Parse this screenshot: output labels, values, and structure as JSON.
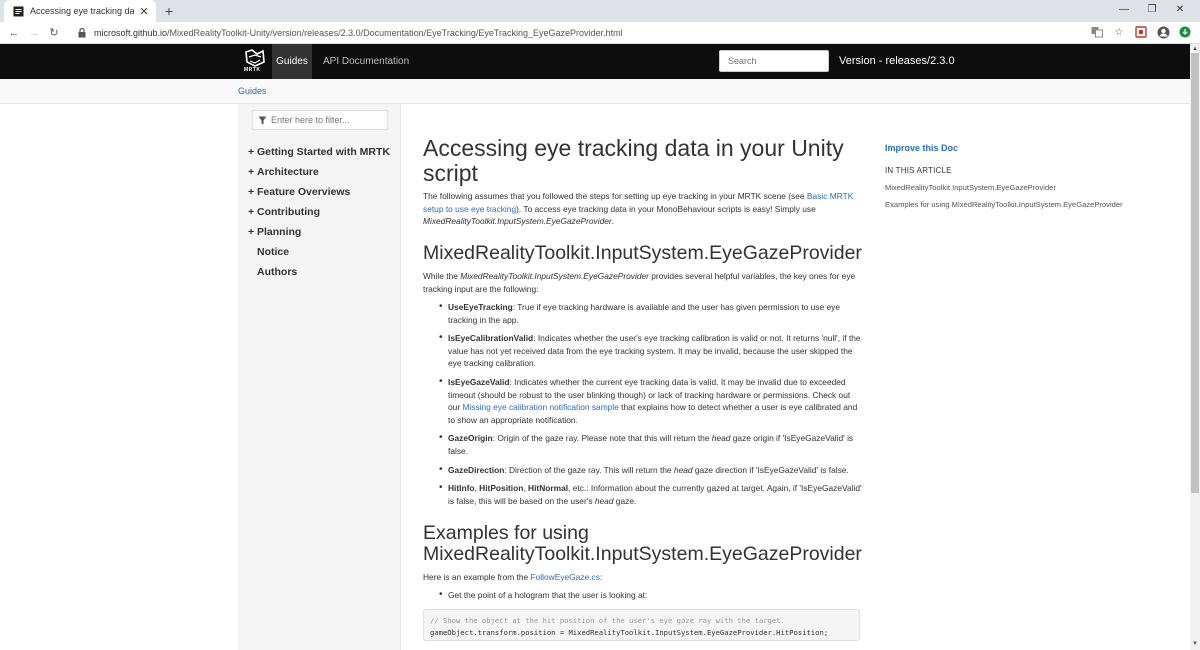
{
  "browser": {
    "tab_title": "Accessing eye tracking data in yo",
    "url_host": "microsoft.github.io",
    "url_path": "/MixedRealityToolkit-Unity/version/releases/2.3.0/Documentation/EyeTracking/EyeTracking_EyeGazeProvider.html"
  },
  "header": {
    "logo_text": "MRTK",
    "nav_guides": "Guides",
    "nav_api": "API Documentation",
    "search_placeholder": "Search",
    "version": "Version - releases/2.3.0"
  },
  "breadcrumb": "Guides",
  "sidebar": {
    "filter_placeholder": "Enter here to filter...",
    "items": [
      {
        "expander": "+",
        "label": "Getting Started with MRTK"
      },
      {
        "expander": "+",
        "label": "Architecture"
      },
      {
        "expander": "+",
        "label": "Feature Overviews"
      },
      {
        "expander": "+",
        "label": "Contributing"
      },
      {
        "expander": "+",
        "label": "Planning"
      },
      {
        "expander": "",
        "label": "Notice"
      },
      {
        "expander": "",
        "label": "Authors"
      }
    ]
  },
  "article": {
    "title": "Accessing eye tracking data in your Unity script",
    "intro_1": "The following assumes that you followed the steps for setting up eye tracking in your MRTK scene (see ",
    "intro_link": "Basic MRTK setup to use eye tracking",
    "intro_2": "). To access eye tracking data in your MonoBehaviour scripts is easy! Simply use ",
    "intro_em": "MixedRealityToolkit.InputSystem.EyeGazeProvider",
    "intro_3": ".",
    "h2_provider": "MixedRealityToolkit.InputSystem.EyeGazeProvider",
    "provider_p1": "While the ",
    "provider_em": "MixedRealityToolkit.InputSystem.EyeGazeProvider",
    "provider_p2": " provides several helpful variables, the key ones for eye tracking input are the following:",
    "items": {
      "use_term": "UseEyeTracking",
      "use_text": ": True if eye tracking hardware is available and the user has given permission to use eye tracking in the app.",
      "calib_term": "IsEyeCalibrationValid",
      "calib_text": ": Indicates whether the user's eye tracking calibration is valid or not. It returns 'null', if the value has not yet received data from the eye tracking system. It may be invalid, because the user skipped the eye tracking calibration.",
      "valid_term": "IsEyeGazeValid",
      "valid_text_1": ": Indicates whether the current eye tracking data is valid. It may be invalid due to exceeded timeout (should be robust to the user blinking though) or lack of tracking hardware or permissions. Check out our ",
      "valid_link": "Missing eye calibration notification sample",
      "valid_text_2": " that explains how to detect whether a user is eye calibrated and to show an appropriate notification.",
      "origin_term": "GazeOrigin",
      "origin_text_1": ": Origin of the gaze ray. Please note that this will return the ",
      "origin_em": "head",
      "origin_text_2": " gaze origin if 'IsEyeGazeValid' is false.",
      "dir_term": "GazeDirection",
      "dir_text_1": ": Direction of the gaze ray. This will return the ",
      "dir_em": "head",
      "dir_text_2": " gaze direction if 'IsEyeGazeValid' is false.",
      "hit_term_1": "HitInfo",
      "hit_sep_1": ", ",
      "hit_term_2": "HitPosition",
      "hit_sep_2": ", ",
      "hit_term_3": "HitNormal",
      "hit_text_1": ", etc.: Information about the currently gazed at target. Again, if 'IsEyeGazeValid' is false, this will be based on the user's ",
      "hit_em": "head",
      "hit_text_2": " gaze."
    },
    "h2_examples": "Examples for using MixedRealityToolkit.InputSystem.EyeGazeProvider",
    "examples_p1": "Here is an example from the ",
    "examples_link": "FollowEyeGaze.cs",
    "examples_p2": ":",
    "examples_li": "Get the point of a hologram that the user is looking at:",
    "code_comment": "// Show the object at the hit position of the user's eye gaze ray with the target.",
    "code_line": "gameObject.transform.position = MixedRealityToolkit.InputSystem.EyeGazeProvider.HitPosition;"
  },
  "affix": {
    "improve": "Improve this Doc",
    "in_this_article": "IN THIS ARTICLE",
    "links": [
      "MixedRealityToolkit.InputSystem.EyeGazeProvider",
      "Examples for using MixedRealityToolkit.InputSystem.EyeGazeProvider"
    ]
  },
  "colors": {
    "link": "#2a6ebb",
    "header_bg": "#0d0d0d",
    "sidebar_bg": "#f5f5f5"
  }
}
